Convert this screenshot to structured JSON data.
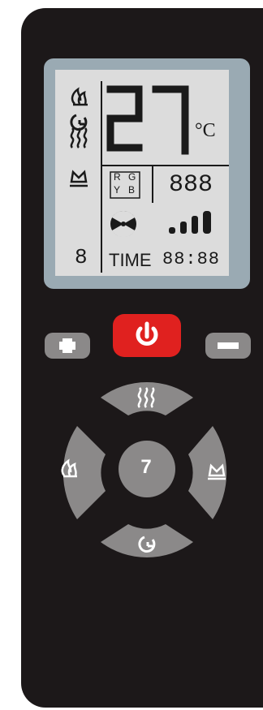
{
  "display": {
    "temperature": "27",
    "unit": "°C",
    "rgb": {
      "r": "R",
      "g": "G",
      "y": "Y",
      "b": "B"
    },
    "counter": "888",
    "time_label": "TIME",
    "time_value": "88:88",
    "mode_digit": "8"
  },
  "buttons": {
    "center_label": "7"
  },
  "colors": {
    "body": "#1c1819",
    "lcd_frame": "#9aaab3",
    "lcd_screen": "#dcdcdc",
    "power": "#e0211f",
    "button": "#8b8989"
  },
  "icons": [
    "flame-icon",
    "timer-icon",
    "heat-wave-icon",
    "crown-icon",
    "fan-icon",
    "signal-bars-icon",
    "power-icon",
    "plus-icon",
    "minus-icon"
  ]
}
